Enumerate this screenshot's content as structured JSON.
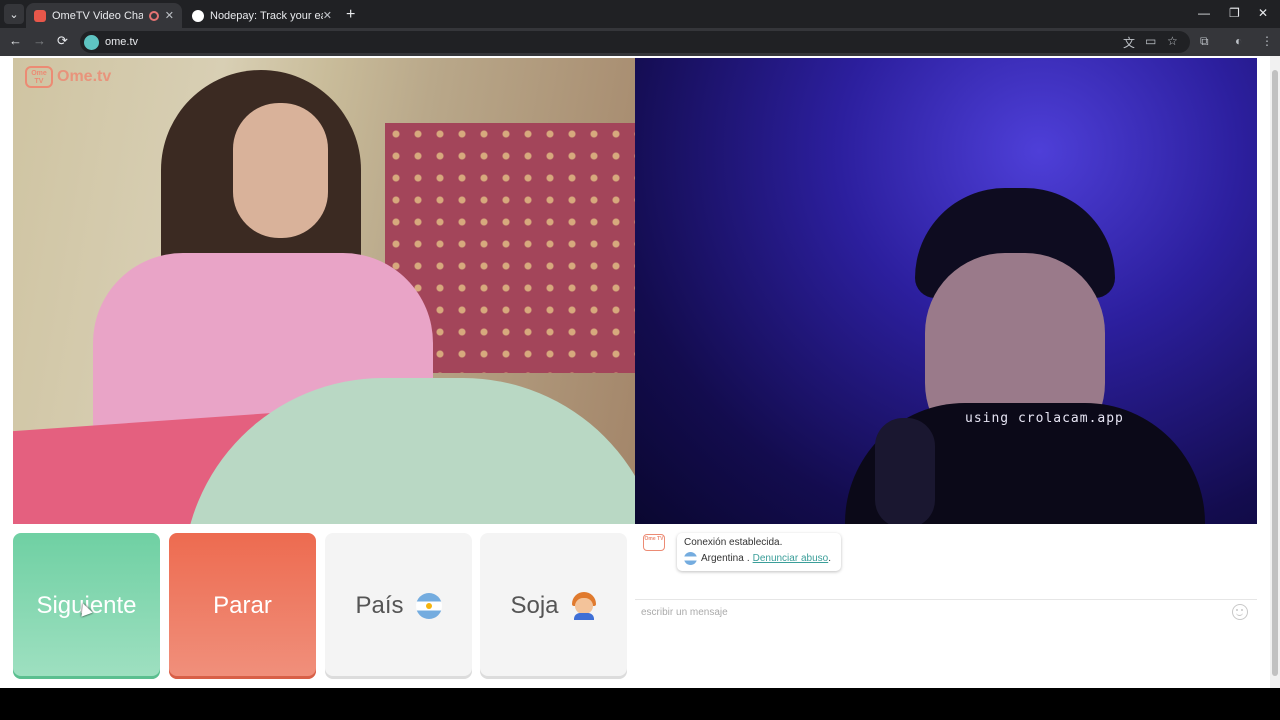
{
  "browser": {
    "tabs": [
      {
        "title": "OmeTV Video Chat — Alte",
        "favicon_color": "#e8574a",
        "recording": true,
        "active": true
      },
      {
        "title": "Nodepay: Track your earnings",
        "favicon_color": "#ffffff",
        "recording": false,
        "active": false
      }
    ],
    "new_tab": "+",
    "window_controls": {
      "minimize": "—",
      "restore": "❐",
      "close": "✕"
    },
    "toolbar": {
      "back": "←",
      "forward": "→",
      "reload": "⟳",
      "url": "ome.tv"
    }
  },
  "left_video": {
    "watermark_logo": "Ome TV",
    "watermark_text": "Ome.tv"
  },
  "right_video": {
    "watermark": "using crolacam.app"
  },
  "buttons": {
    "next": "Siguiente",
    "stop": "Parar",
    "country": "País",
    "gender": "Soja"
  },
  "chat": {
    "logo": "Ome TV",
    "status": "Conexión establecida.",
    "country": "Argentina",
    "separator": ".",
    "report_link": "Denunciar abuso",
    "report_suffix": ".",
    "input_placeholder": "escribir un mensaje"
  },
  "colors": {
    "next_button": "#6fd0a3",
    "stop_button": "#ed6b50",
    "accent_link": "#3a9e99",
    "brand": "#ec8b74"
  }
}
